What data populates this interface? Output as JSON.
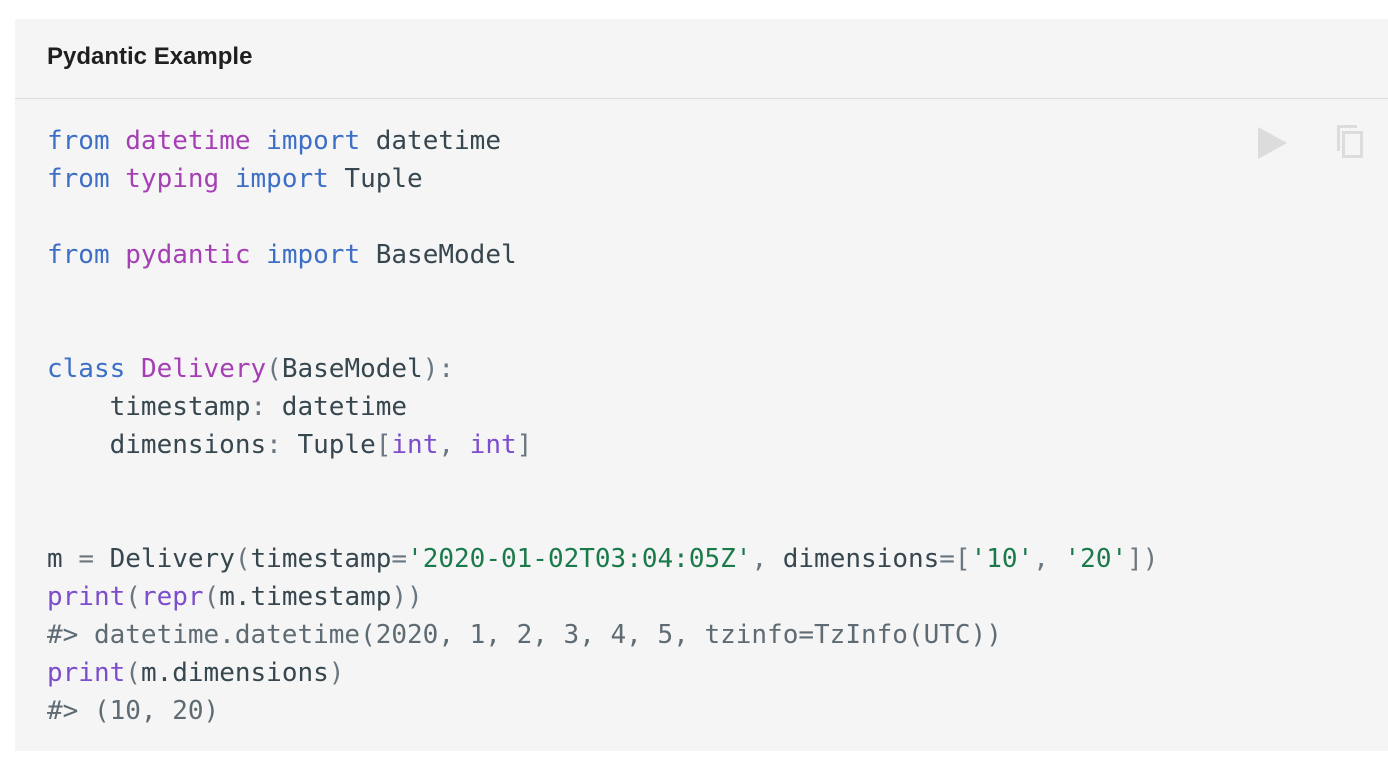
{
  "card": {
    "title": "Pydantic Example"
  },
  "toolbar": {
    "run_icon": "play-icon",
    "copy_icon": "copy-icon"
  },
  "code": {
    "language": "python",
    "lines": [
      [
        {
          "t": "kw",
          "v": "from"
        },
        {
          "t": "txt",
          "v": " "
        },
        {
          "t": "mod",
          "v": "datetime"
        },
        {
          "t": "txt",
          "v": " "
        },
        {
          "t": "kw",
          "v": "import"
        },
        {
          "t": "txt",
          "v": " datetime"
        }
      ],
      [
        {
          "t": "kw",
          "v": "from"
        },
        {
          "t": "txt",
          "v": " "
        },
        {
          "t": "mod",
          "v": "typing"
        },
        {
          "t": "txt",
          "v": " "
        },
        {
          "t": "kw",
          "v": "import"
        },
        {
          "t": "txt",
          "v": " Tuple"
        }
      ],
      [],
      [
        {
          "t": "kw",
          "v": "from"
        },
        {
          "t": "txt",
          "v": " "
        },
        {
          "t": "mod",
          "v": "pydantic"
        },
        {
          "t": "txt",
          "v": " "
        },
        {
          "t": "kw",
          "v": "import"
        },
        {
          "t": "txt",
          "v": " BaseModel"
        }
      ],
      [],
      [],
      [
        {
          "t": "kw",
          "v": "class"
        },
        {
          "t": "txt",
          "v": " "
        },
        {
          "t": "cls",
          "v": "Delivery"
        },
        {
          "t": "pun",
          "v": "("
        },
        {
          "t": "txt",
          "v": "BaseModel"
        },
        {
          "t": "pun",
          "v": "):"
        }
      ],
      [
        {
          "t": "txt",
          "v": "    timestamp"
        },
        {
          "t": "pun",
          "v": ":"
        },
        {
          "t": "txt",
          "v": " datetime"
        }
      ],
      [
        {
          "t": "txt",
          "v": "    dimensions"
        },
        {
          "t": "pun",
          "v": ":"
        },
        {
          "t": "txt",
          "v": " Tuple"
        },
        {
          "t": "pun",
          "v": "["
        },
        {
          "t": "type",
          "v": "int"
        },
        {
          "t": "pun",
          "v": ","
        },
        {
          "t": "txt",
          "v": " "
        },
        {
          "t": "type",
          "v": "int"
        },
        {
          "t": "pun",
          "v": "]"
        }
      ],
      [],
      [],
      [
        {
          "t": "txt",
          "v": "m "
        },
        {
          "t": "pun",
          "v": "="
        },
        {
          "t": "txt",
          "v": " Delivery"
        },
        {
          "t": "pun",
          "v": "("
        },
        {
          "t": "txt",
          "v": "timestamp"
        },
        {
          "t": "pun",
          "v": "="
        },
        {
          "t": "str",
          "v": "'2020-01-02T03:04:05Z'"
        },
        {
          "t": "pun",
          "v": ","
        },
        {
          "t": "txt",
          "v": " dimensions"
        },
        {
          "t": "pun",
          "v": "=["
        },
        {
          "t": "str",
          "v": "'10'"
        },
        {
          "t": "pun",
          "v": ","
        },
        {
          "t": "txt",
          "v": " "
        },
        {
          "t": "str",
          "v": "'20'"
        },
        {
          "t": "pun",
          "v": "])"
        }
      ],
      [
        {
          "t": "fn",
          "v": "print"
        },
        {
          "t": "pun",
          "v": "("
        },
        {
          "t": "fn",
          "v": "repr"
        },
        {
          "t": "pun",
          "v": "("
        },
        {
          "t": "txt",
          "v": "m.timestamp"
        },
        {
          "t": "pun",
          "v": "))"
        }
      ],
      [
        {
          "t": "com",
          "v": "#> datetime.datetime(2020, 1, 2, 3, 4, 5, tzinfo=TzInfo(UTC))"
        }
      ],
      [
        {
          "t": "fn",
          "v": "print"
        },
        {
          "t": "pun",
          "v": "("
        },
        {
          "t": "txt",
          "v": "m.dimensions"
        },
        {
          "t": "pun",
          "v": ")"
        }
      ],
      [
        {
          "t": "com",
          "v": "#> (10, 20)"
        }
      ]
    ]
  },
  "colors": {
    "background": "#f5f5f5",
    "keyword": "#3d6fc6",
    "module": "#a63fb5",
    "builtin": "#7c4dcc",
    "string": "#1b7a4a",
    "comment": "#5e6b73",
    "icon": "#dcdcdc"
  }
}
